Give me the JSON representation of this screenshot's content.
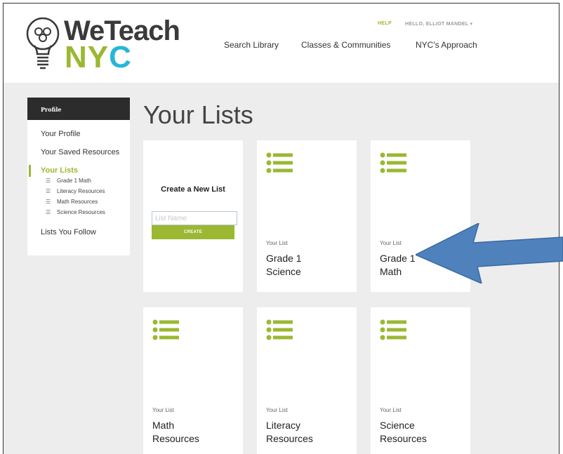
{
  "brand": {
    "line1": "WeTeach",
    "line2_n": "N",
    "line2_y": "Y",
    "line2_c": "C"
  },
  "utility": {
    "help": "HELP",
    "greeting": "HELLO, ELLIOT MANDEL ▾"
  },
  "nav": [
    {
      "label": "Search Library"
    },
    {
      "label": "Classes & Communities"
    },
    {
      "label": "NYC's Approach"
    }
  ],
  "sidebar": {
    "heading": "Profile",
    "profile": "Your Profile",
    "saved": "Your Saved Resources",
    "active": "Your Lists",
    "sublists": [
      "Grade 1 Math",
      "Literacy Resources",
      "Math Resources",
      "Science Resources"
    ],
    "follow": "Lists You Follow"
  },
  "page_title": "Your Lists",
  "create": {
    "heading": "Create a New List",
    "placeholder": "List Name",
    "button": "CREATE"
  },
  "cards": [
    {
      "kicker": "Your List",
      "name_line1": "Grade 1",
      "name_line2": "Science"
    },
    {
      "kicker": "Your List",
      "name_line1": "Grade 1",
      "name_line2": "Math"
    },
    {
      "kicker": "Your List",
      "name_line1": "Math",
      "name_line2": "Resources"
    },
    {
      "kicker": "Your List",
      "name_line1": "Literacy",
      "name_line2": "Resources"
    },
    {
      "kicker": "Your List",
      "name_line1": "Science",
      "name_line2": "Resources"
    }
  ],
  "colors": {
    "accent": "#9ab832",
    "brand_blue": "#27b6d6",
    "annotation_arrow": "#4f81bd",
    "sidebar_head": "#2c2c2c"
  },
  "icons": {
    "list": "list-icon",
    "bulb": "lightbulb-icon",
    "arrow": "annotation-arrow"
  }
}
